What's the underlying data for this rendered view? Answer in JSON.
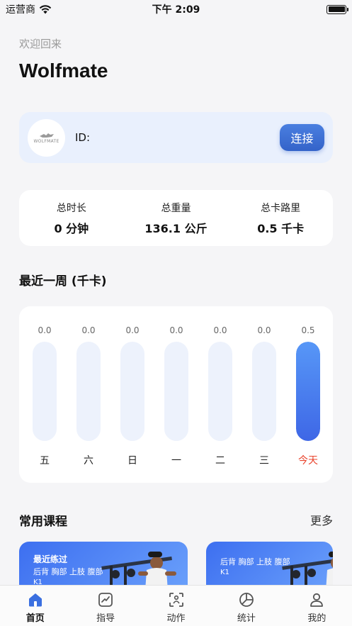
{
  "status_bar": {
    "carrier": "运营商",
    "time": "下午 2:09",
    "battery_level": 1.0
  },
  "header": {
    "welcome": "欢迎回来",
    "title": "Wolfmate"
  },
  "device": {
    "logo_text": "WOLFMATE",
    "id_label": "ID:",
    "connect_label": "连接"
  },
  "stats": [
    {
      "label": "总时长",
      "value": "0 分钟"
    },
    {
      "label": "总重量",
      "value": "136.1 公斤"
    },
    {
      "label": "总卡路里",
      "value": "0.5 千卡"
    }
  ],
  "weekly": {
    "title": "最近一周 (千卡)",
    "today_color": "#e9442d",
    "accent": "#3e67e6"
  },
  "chart_data": {
    "type": "bar",
    "categories": [
      "五",
      "六",
      "日",
      "一",
      "二",
      "三",
      "今天"
    ],
    "values": [
      0.0,
      0.0,
      0.0,
      0.0,
      0.0,
      0.0,
      0.5
    ],
    "value_labels": [
      "0.0",
      "0.0",
      "0.0",
      "0.0",
      "0.0",
      "0.0",
      "0.5"
    ],
    "ylim": [
      0,
      0.5
    ],
    "title": "最近一周 (千卡)",
    "grid": false
  },
  "courses": {
    "title": "常用课程",
    "more_label": "更多",
    "items": [
      {
        "heading": "最近练过",
        "tags": "后背 胸部 上肢 腹部",
        "model": "K1"
      },
      {
        "heading": "",
        "tags": "后背 胸部 上肢 腹部",
        "model": "K1"
      }
    ]
  },
  "tabs": [
    {
      "label": "首页",
      "icon": "home-icon",
      "active": true
    },
    {
      "label": "指导",
      "icon": "guide-chart-icon",
      "active": false
    },
    {
      "label": "动作",
      "icon": "motion-scan-icon",
      "active": false
    },
    {
      "label": "统计",
      "icon": "pie-chart-icon",
      "active": false
    },
    {
      "label": "我的",
      "icon": "user-icon",
      "active": false
    }
  ]
}
